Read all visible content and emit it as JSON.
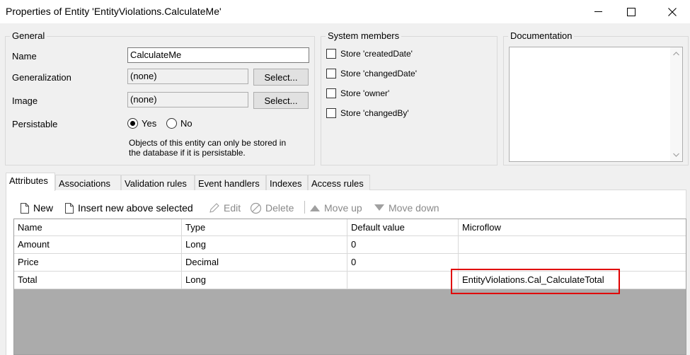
{
  "window": {
    "title": "Properties of Entity 'EntityViolations.CalculateMe'"
  },
  "general": {
    "legend": "General",
    "name_label": "Name",
    "name_value": "CalculateMe",
    "generalization_label": "Generalization",
    "generalization_value": "(none)",
    "generalization_button": "Select...",
    "image_label": "Image",
    "image_value": "(none)",
    "image_button": "Select...",
    "persistable_label": "Persistable",
    "persistable_yes": "Yes",
    "persistable_no": "No",
    "persistable_selected": "Yes",
    "persistable_note_line1": "Objects of this entity can only be stored in",
    "persistable_note_line2": "the database if it is persistable."
  },
  "system_members": {
    "legend": "System members",
    "items": [
      {
        "label": "Store 'createdDate'",
        "checked": false
      },
      {
        "label": "Store 'changedDate'",
        "checked": false
      },
      {
        "label": "Store 'owner'",
        "checked": false
      },
      {
        "label": "Store 'changedBy'",
        "checked": false
      }
    ]
  },
  "documentation": {
    "legend": "Documentation",
    "value": ""
  },
  "tabs": [
    {
      "label": "Attributes",
      "active": true
    },
    {
      "label": "Associations",
      "active": false
    },
    {
      "label": "Validation rules",
      "active": false
    },
    {
      "label": "Event handlers",
      "active": false
    },
    {
      "label": "Indexes",
      "active": false
    },
    {
      "label": "Access rules",
      "active": false
    }
  ],
  "toolbar": {
    "new": "New",
    "insert": "Insert new above selected",
    "edit": "Edit",
    "delete": "Delete",
    "move_up": "Move up",
    "move_down": "Move down"
  },
  "attributes_table": {
    "columns": [
      "Name",
      "Type",
      "Default value",
      "Microflow"
    ],
    "rows": [
      [
        "Amount",
        "Long",
        "0",
        ""
      ],
      [
        "Price",
        "Decimal",
        "0",
        ""
      ],
      [
        "Total",
        "Long",
        "",
        "EntityViolations.Cal_CalculateTotal"
      ]
    ]
  },
  "colors": {
    "highlight": "#e00000",
    "grid_empty": "#ababab"
  }
}
